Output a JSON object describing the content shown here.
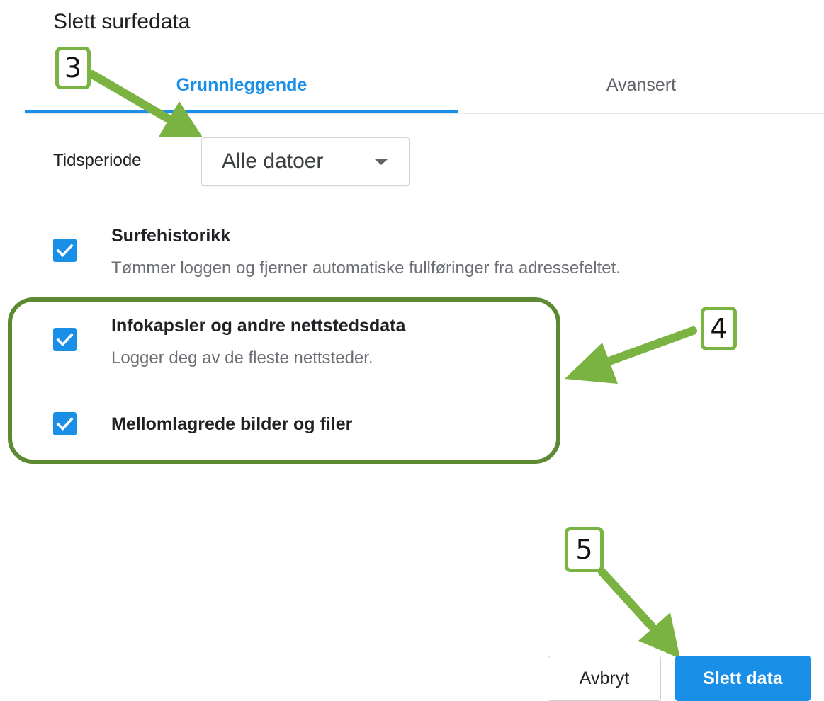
{
  "dialog": {
    "title": "Slett surfedata"
  },
  "tabs": [
    {
      "label": "Grunnleggende",
      "active": true
    },
    {
      "label": "Avansert",
      "active": false
    }
  ],
  "time_range": {
    "label": "Tidsperiode",
    "selected": "Alle datoer"
  },
  "options": [
    {
      "title": "Surfehistorikk",
      "description": "Tømmer loggen og fjerner automatiske fullføringer fra adressefeltet.",
      "checked": true
    },
    {
      "title": "Infokapsler og andre nettstedsdata",
      "description": "Logger deg av de fleste nettsteder.",
      "checked": true
    },
    {
      "title": "Mellomlagrede bilder og filer",
      "description": "",
      "checked": true
    }
  ],
  "buttons": {
    "cancel": "Avbryt",
    "confirm": "Slett data"
  },
  "annotations": {
    "step3": "3",
    "step4": "4",
    "step5": "5"
  },
  "colors": {
    "accent": "#1a8fe8",
    "annotation_green": "#7bb342",
    "annotation_dark_green": "#5b8a33"
  }
}
